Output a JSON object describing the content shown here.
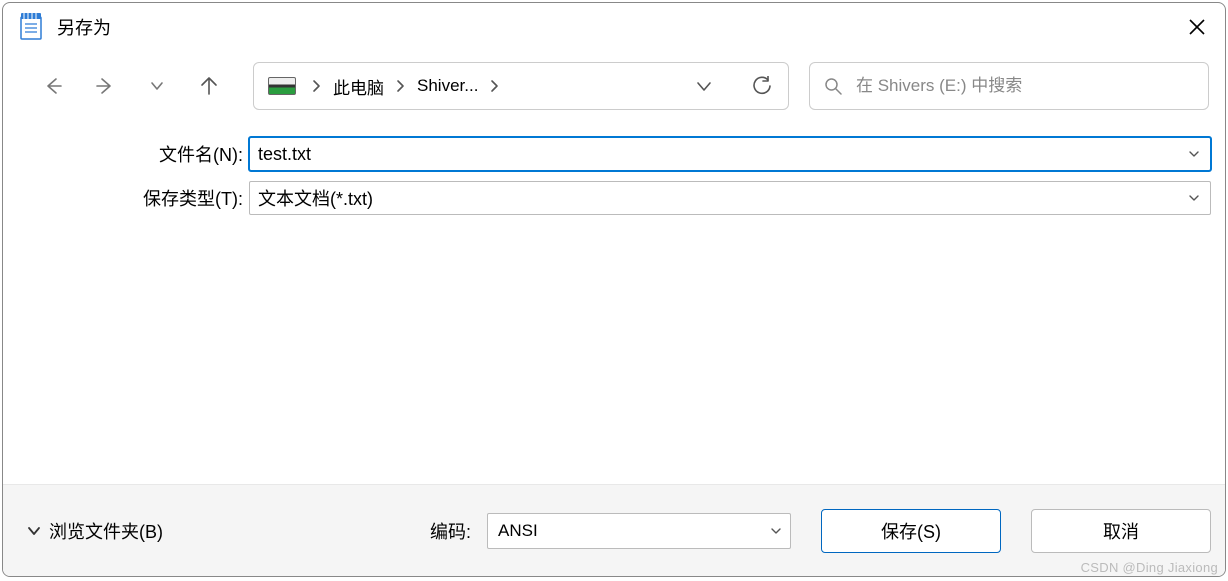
{
  "title": "另存为",
  "breadcrumb": {
    "items": [
      "此电脑",
      "Shiver..."
    ]
  },
  "search": {
    "placeholder": "在 Shivers (E:) 中搜索"
  },
  "form": {
    "filename_label": "文件名(N):",
    "filename_value": "test.txt",
    "filetype_label": "保存类型(T):",
    "filetype_value": "文本文档(*.txt)"
  },
  "footer": {
    "browse_label": "浏览文件夹(B)",
    "encoding_label": "编码:",
    "encoding_value": "ANSI",
    "save_label": "保存(S)",
    "cancel_label": "取消"
  },
  "watermark": "CSDN @Ding Jiaxiong"
}
